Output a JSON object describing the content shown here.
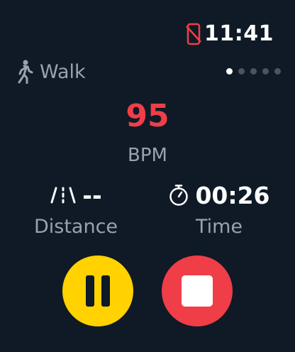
{
  "status": {
    "time": "11:41",
    "phone_icon": "phone-disconnected-icon",
    "phone_icon_color": "#ef3e48"
  },
  "activity": {
    "label": "Walk",
    "icon": "walk-icon"
  },
  "pager": {
    "count": 5,
    "active_index": 0
  },
  "heart_rate": {
    "value": "95",
    "unit": "BPM",
    "color": "#ef3e48"
  },
  "distance": {
    "value": "--",
    "label": "Distance",
    "icon": "road-icon"
  },
  "time": {
    "value": "00:26",
    "label": "Time",
    "icon": "stopwatch-icon"
  },
  "controls": {
    "pause": {
      "icon": "pause-icon",
      "color": "#ffd200"
    },
    "stop": {
      "icon": "stop-icon",
      "color": "#ef3e48"
    }
  },
  "colors": {
    "background": "#0f1a26",
    "secondary_text": "#9aa3ad"
  }
}
